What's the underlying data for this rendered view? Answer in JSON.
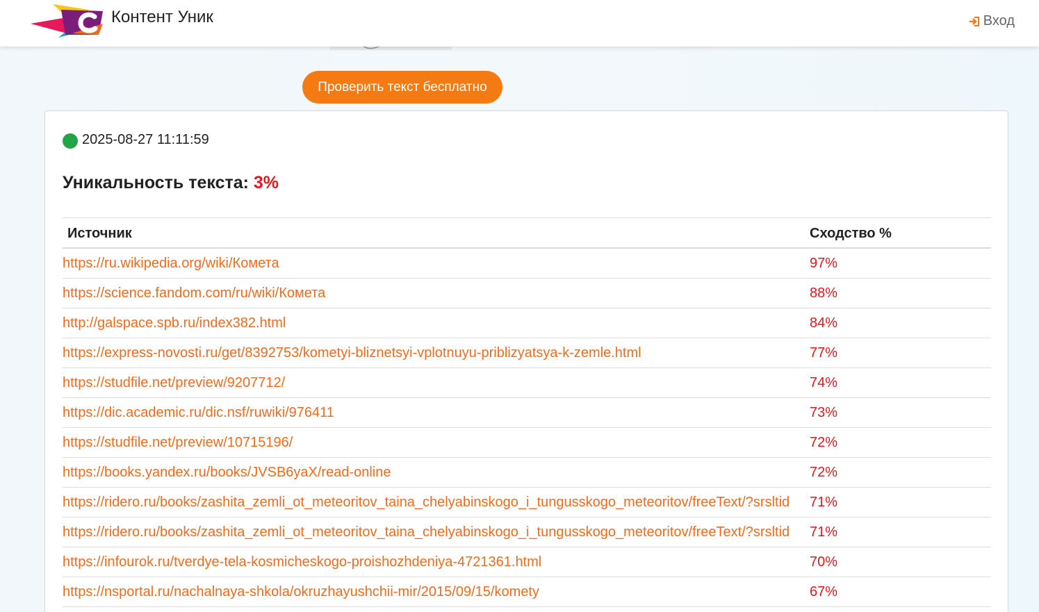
{
  "header": {
    "brand": "Контент Уник",
    "login_label": "Вход",
    "login_icon": "sign-in-icon"
  },
  "actions": {
    "check_button": "Проверить текст бесплатно"
  },
  "result": {
    "timestamp": "2025-08-27 11:11:59",
    "status_color": "#22a447",
    "uniqueness_label": "Уникальность текста:",
    "uniqueness_value": "3%"
  },
  "table": {
    "col_source": "Источник",
    "col_similarity": "Сходство %",
    "rows": [
      {
        "url": "https://ru.wikipedia.org/wiki/Комета",
        "sim": "97%"
      },
      {
        "url": "https://science.fandom.com/ru/wiki/Комета",
        "sim": "88%"
      },
      {
        "url": "http://galspace.spb.ru/index382.html",
        "sim": "84%"
      },
      {
        "url": "https://express-novosti.ru/get/8392753/kometyi-bliznetsyi-vplotnuyu-priblizyatsya-k-zemle.html",
        "sim": "77%"
      },
      {
        "url": "https://studfile.net/preview/9207712/",
        "sim": "74%"
      },
      {
        "url": "https://dic.academic.ru/dic.nsf/ruwiki/976411",
        "sim": "73%"
      },
      {
        "url": "https://studfile.net/preview/10715196/",
        "sim": "72%"
      },
      {
        "url": "https://books.yandex.ru/books/JVSB6yaX/read-online",
        "sim": "72%"
      },
      {
        "url": "https://ridero.ru/books/zashita_zemli_ot_meteoritov_taina_chelyabinskogo_i_tungusskogo_meteoritov/freeText/?srsltid",
        "sim": "71%"
      },
      {
        "url": "https://ridero.ru/books/zashita_zemli_ot_meteoritov_taina_chelyabinskogo_i_tungusskogo_meteoritov/freeText/?srsltid",
        "sim": "71%"
      },
      {
        "url": "https://infourok.ru/tverdye-tela-kosmicheskogo-proishozhdeniya-4721361.html",
        "sim": "70%"
      },
      {
        "url": "https://nsportal.ru/nachalnaya-shkola/okruzhayushchii-mir/2015/09/15/komety",
        "sim": "67%"
      }
    ]
  },
  "colors": {
    "accent": "#f47a13",
    "link": "#f26b1d",
    "percent": "#e8161b"
  }
}
